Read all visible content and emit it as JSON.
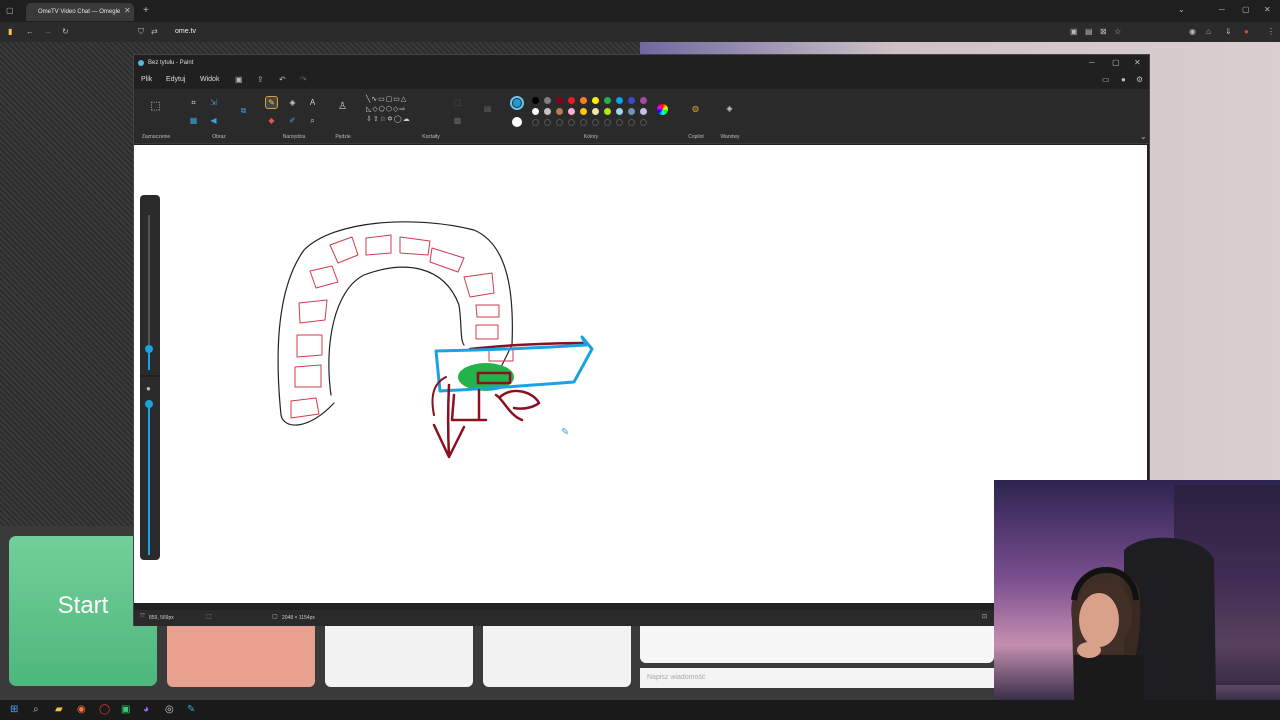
{
  "browser": {
    "tab_title": "OmeTV Video Chat — Omegle",
    "new_tab": "+",
    "url": "ome.tv"
  },
  "paint": {
    "title": "Bez tytułu - Paint",
    "menu": [
      "Plik",
      "Edytuj",
      "Widok"
    ],
    "groups": [
      "Zaznaczenie",
      "Obraz",
      "Narzędzia",
      "Pędzle",
      "Kształty",
      "Kolory",
      "Copilot",
      "Warstwy"
    ],
    "colors": {
      "row1": [
        "#000000",
        "#7f7f7f",
        "#880015",
        "#ed1c24",
        "#ff7f27",
        "#fff200",
        "#22b14c",
        "#00a2e8",
        "#3f48cc",
        "#a349a4"
      ],
      "row2": [
        "#ffffff",
        "#c3c3c3",
        "#b97a57",
        "#ffaec9",
        "#ffc90e",
        "#efe4b0",
        "#b5e61d",
        "#99d9ea",
        "#7092be",
        "#c8bfe7"
      ],
      "primary": "#1e9bd7",
      "secondary": "#ffffff"
    },
    "status": {
      "cursor": "859, 569px",
      "canvas_size": "2048 × 1154px"
    }
  },
  "app": {
    "start_label": "Start",
    "message_placeholder": "Napisz wiadomość"
  }
}
